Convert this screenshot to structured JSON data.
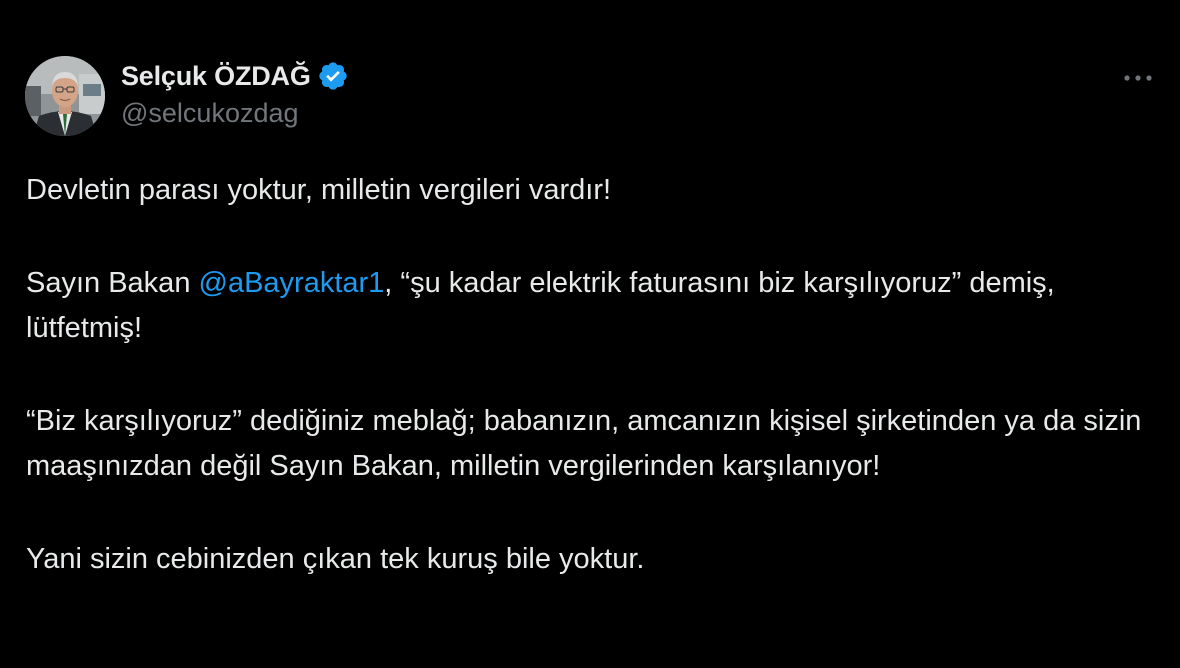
{
  "author": {
    "display_name": "Selçuk ÖZDAĞ",
    "handle": "@selcukozdag",
    "verified": true,
    "avatar": "person-portrait-avatar"
  },
  "header": {
    "more_icon": "more-horizontal-icon"
  },
  "tweet": {
    "p1": "Devletin parası yoktur, milletin vergileri vardır!",
    "p2_before": "Sayın Bakan ",
    "p2_mention": "@aBayraktar1",
    "p2_after": ", “şu kadar elektrik faturasını biz karşılıyoruz” demiş, lütfetmiş!",
    "p3": "“Biz karşılıyoruz” dediğiniz meblağ; babanızın, amcanızın kişisel şirketinden ya da sizin maaşınızdan değil Sayın Bakan, milletin vergilerinden karşılanıyor!",
    "p4": "Yani sizin cebinizden çıkan tek kuruş bile yoktur."
  },
  "colors": {
    "background": "#000000",
    "text": "#e7e9ea",
    "secondary": "#71767b",
    "accent": "#1d9bf0"
  }
}
